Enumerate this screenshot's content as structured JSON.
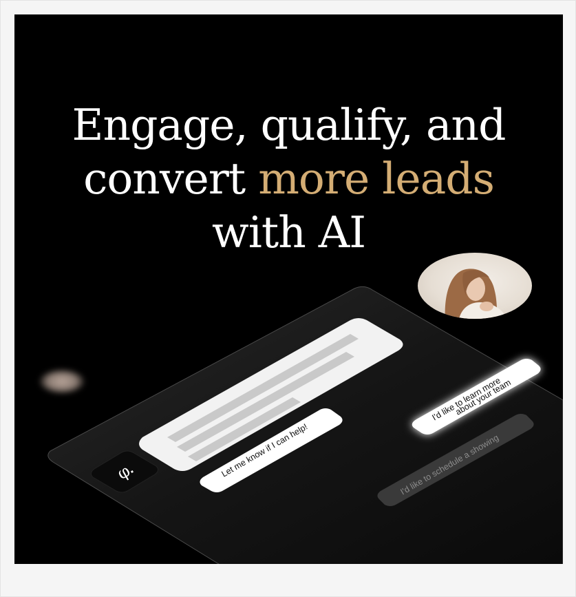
{
  "headline": {
    "line1": "Engage, qualify, and",
    "line2_prefix": "convert ",
    "line2_accent": "more leads",
    "line3": "with AI"
  },
  "chat": {
    "agent_message": "Let me know if I can help!",
    "visitor_message_1": "I'd like to learn more",
    "visitor_message_1b": "about your team",
    "visitor_message_2": "I'd like to schedule a showing"
  },
  "colors": {
    "background": "#000000",
    "accent": "#d4ad74",
    "text": "#ffffff"
  },
  "icons": {
    "logo": "brand-logo-icon"
  }
}
